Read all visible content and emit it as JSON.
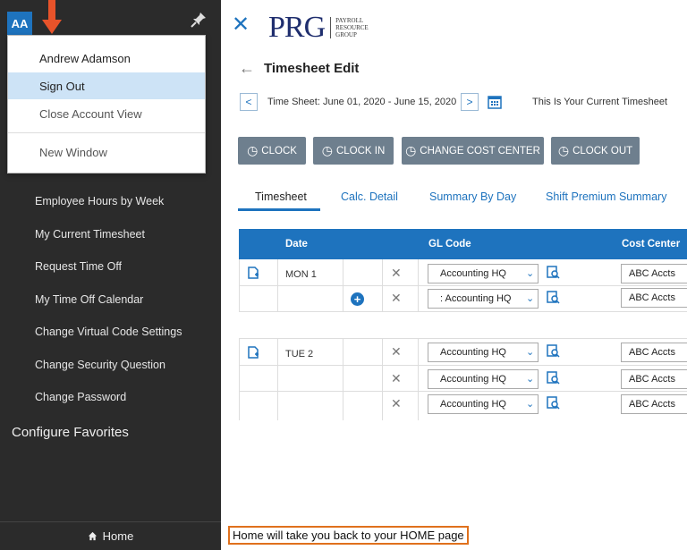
{
  "user": {
    "initials": "AA"
  },
  "dropdown": {
    "name": "Andrew Adamson",
    "sign_out": "Sign Out",
    "close_account": "Close Account View",
    "new_window": "New Window"
  },
  "sidebar": {
    "items": [
      {
        "label": "Employee Hours by Week"
      },
      {
        "label": "My Current Timesheet"
      },
      {
        "label": "Request Time Off"
      },
      {
        "label": "My Time Off Calendar"
      },
      {
        "label": "Change Virtual Code Settings"
      },
      {
        "label": "Change Security Question"
      },
      {
        "label": "Change Password"
      }
    ],
    "favorites": "Configure Favorites",
    "home": "Home"
  },
  "logo": {
    "main": "PRG",
    "line1": "PAYROLL",
    "line2": "RESOURCE",
    "line3": "GROUP"
  },
  "page": {
    "title": "Timesheet Edit",
    "period": "Time Sheet: June 01, 2020 - June 15, 2020",
    "current_label": "This Is Your Current Timesheet"
  },
  "actions": {
    "clock": "CLOCK",
    "clock_in": "CLOCK IN",
    "change_cost_center": "CHANGE COST CENTER",
    "clock_out": "CLOCK OUT"
  },
  "tabs": [
    "Timesheet",
    "Calc. Detail",
    "Summary By Day",
    "Shift Premium Summary"
  ],
  "table": {
    "headers": {
      "date": "Date",
      "gl_code": "GL Code",
      "cost_center": "Cost Center"
    },
    "rows": [
      {
        "date": "MON 1",
        "gl": "Accounting HQ",
        "cc": "ABC Accts"
      },
      {
        "date": "",
        "gl": ": Accounting HQ",
        "cc": "ABC Accts"
      },
      {
        "date": "TUE 2",
        "gl": "Accounting HQ",
        "cc": "ABC Accts"
      },
      {
        "date": "",
        "gl": "Accounting HQ",
        "cc": "ABC Accts"
      },
      {
        "date": "",
        "gl": "Accounting HQ",
        "cc": "ABC Accts"
      }
    ]
  },
  "caption": "Home will take you back to your HOME page",
  "colors": {
    "accent": "#1e73be",
    "sidebar": "#2b2b2b",
    "highlight": "#cde3f6",
    "callout": "#e0711d",
    "arrow": "#e8532a"
  }
}
